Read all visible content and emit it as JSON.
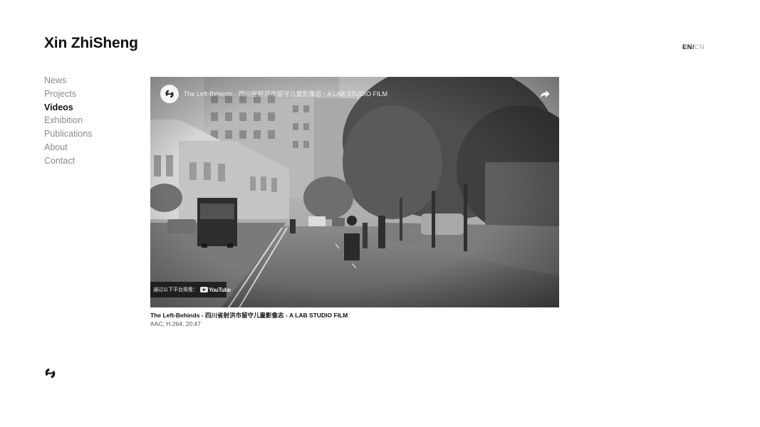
{
  "site": {
    "title": "Xin ZhiSheng"
  },
  "lang": {
    "active": "EN",
    "separator": "/",
    "inactive": "CN"
  },
  "nav": {
    "items": [
      "News",
      "Projects",
      "Videos",
      "Exhibition",
      "Publications",
      "About",
      "Contact"
    ],
    "active": "Videos"
  },
  "video": {
    "player_title": "The Left-Behinds - 四川省射洪市留守儿童影像志 - A LAB STUDIO FILM",
    "watch_on_label": "通过以下平台观看：",
    "watch_on_brand": "YouTube",
    "logo_icon": "lab-studio-logo-icon",
    "share_icon": "share-arrow-icon"
  },
  "caption": {
    "title": "The Left-Behinds - 四川省射洪市留守儿童影像志 - A LAB STUDIO FILM",
    "meta": "AAC, H.264,  20:47"
  },
  "footer": {
    "logo_icon": "lab-studio-logo-icon"
  }
}
